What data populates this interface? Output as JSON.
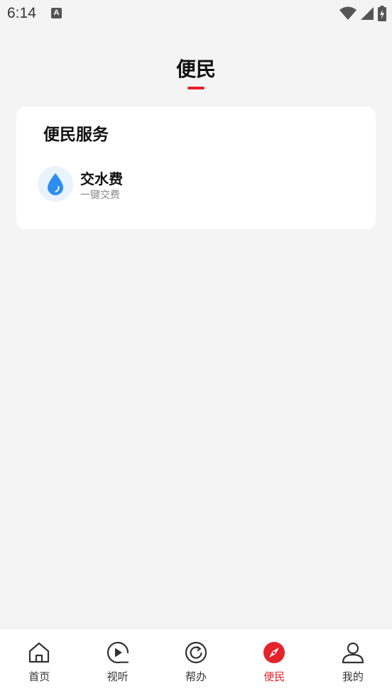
{
  "status_bar": {
    "time": "6:14",
    "notification_letter": "A"
  },
  "page": {
    "title": "便民",
    "accent_color": "#e4232b"
  },
  "services_card": {
    "title": "便民服务",
    "items": [
      {
        "name": "交水费",
        "desc": "一键交费",
        "icon": "water-drop-icon",
        "icon_color": "#2b8ef0"
      }
    ]
  },
  "bottom_nav": {
    "items": [
      {
        "label": "首页",
        "icon": "home-icon"
      },
      {
        "label": "视听",
        "icon": "play-icon"
      },
      {
        "label": "帮办",
        "icon": "refresh-c-icon"
      },
      {
        "label": "便民",
        "icon": "compass-icon",
        "active": true
      },
      {
        "label": "我的",
        "icon": "person-icon"
      }
    ]
  }
}
